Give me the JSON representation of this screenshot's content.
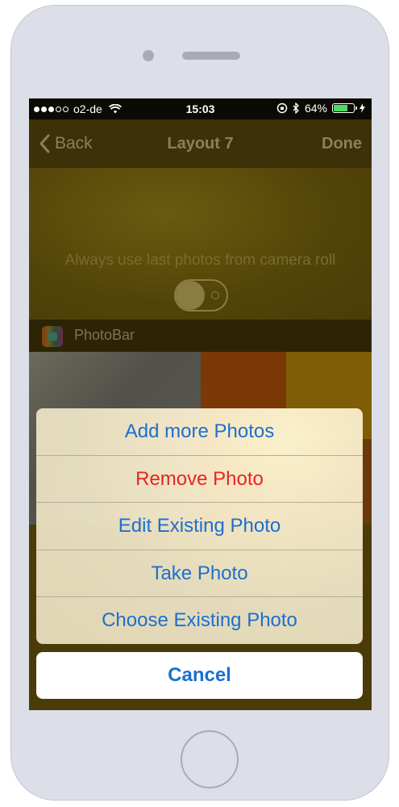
{
  "status_bar": {
    "carrier": "o2-de",
    "time": "15:03",
    "battery_percent": "64%",
    "battery_level": 0.64,
    "signal_dots_filled": 3,
    "signal_dots_total": 5
  },
  "nav": {
    "back_label": "Back",
    "title": "Layout 7",
    "done_label": "Done"
  },
  "settings": {
    "toggle_label": "Always use last photos from camera roll",
    "toggle_on": false
  },
  "section": {
    "title": "PhotoBar"
  },
  "action_sheet": {
    "items": [
      {
        "label": "Add more Photos",
        "destructive": false
      },
      {
        "label": "Remove Photo",
        "destructive": true
      },
      {
        "label": "Edit Existing Photo",
        "destructive": false
      },
      {
        "label": "Take Photo",
        "destructive": false
      },
      {
        "label": "Choose Existing Photo",
        "destructive": false
      }
    ],
    "cancel_label": "Cancel"
  },
  "colors": {
    "action_blue": "#1b6fd0",
    "destructive_red": "#e8261e",
    "battery_green": "#4cd964"
  }
}
